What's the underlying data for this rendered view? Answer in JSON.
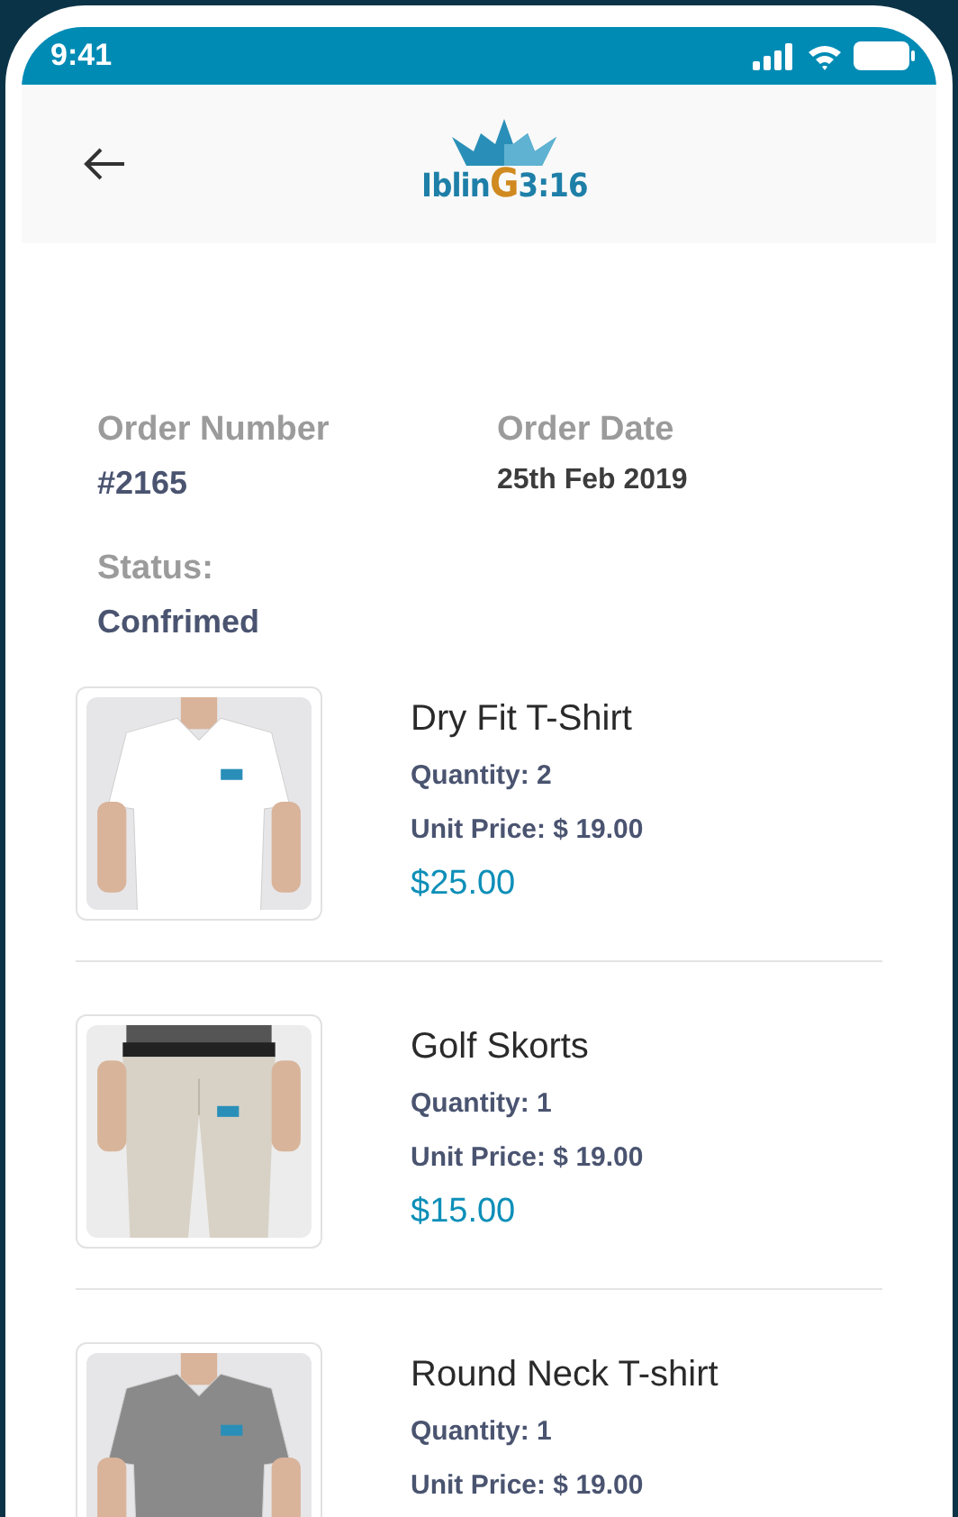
{
  "status_bar": {
    "time": "9:41"
  },
  "header": {
    "logo": {
      "before": "Iblin",
      "highlight": "G",
      "after": "3:16"
    }
  },
  "order": {
    "fields": [
      {
        "label": "Order Number",
        "value": "#2165"
      },
      {
        "label": "Order Date",
        "value": "25th Feb 2019"
      },
      {
        "label": "Status:",
        "value": "Confrimed"
      }
    ]
  },
  "items": [
    {
      "name": "Dry Fit T-Shirt",
      "quantity": "Quantity: 2",
      "unit_price": "Unit Price: $ 19.00",
      "price": "$25.00",
      "kind": "picture"
    },
    {
      "name": "Golf Skorts",
      "quantity": "Quantity: 1",
      "unit_price": "Unit Price: $ 19.00",
      "price": "$15.00",
      "kind": "picture"
    },
    {
      "name": "Round Neck T-shirt",
      "quantity": "Quantity: 1",
      "unit_price": "Unit Price: $ 19.00",
      "kind": "picture"
    }
  ]
}
